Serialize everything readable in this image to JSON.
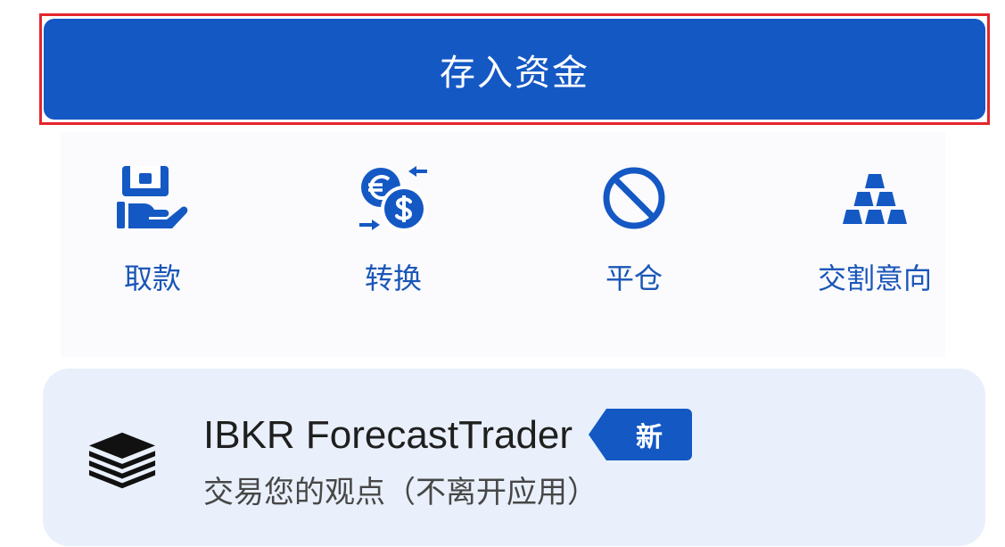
{
  "deposit_button": {
    "label": "存入资金"
  },
  "actions": [
    {
      "label": "取款",
      "icon": "hand-cash-icon"
    },
    {
      "label": "转换",
      "icon": "currency-exchange-icon"
    },
    {
      "label": "平仓",
      "icon": "prohibited-icon"
    },
    {
      "label": "交割意向",
      "icon": "gold-bars-icon"
    }
  ],
  "promo": {
    "title": "IBKR ForecastTrader",
    "badge": "新",
    "subtitle": "交易您的观点（不离开应用）",
    "icon": "layers-icon"
  },
  "colors": {
    "primary": "#1458c4",
    "highlight": "#e3262b",
    "card_bg": "#e9f0fb",
    "text_dark": "#1f1f1f",
    "text_muted": "#474747",
    "label": "#1a56b8"
  }
}
